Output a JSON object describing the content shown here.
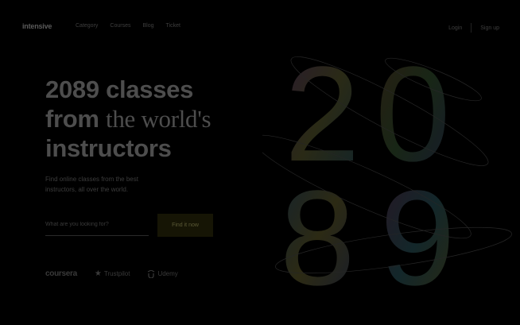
{
  "nav": {
    "logo": "intensive",
    "links": [
      "Category",
      "Courses",
      "Blog",
      "Ticket"
    ],
    "login": "Login",
    "signup": "Sign up"
  },
  "hero": {
    "line1": "2089 classes",
    "line2_sans": "from ",
    "line2_serif": "the world's",
    "line3": "instructors",
    "subtitle": "Find online classes from the best instructors, all over the world."
  },
  "form": {
    "placeholder": "What are you looking for?",
    "button": "Find it now"
  },
  "partners": {
    "coursera": "coursera",
    "trustpilot": "Trustpilot",
    "udemy": "Udemy"
  },
  "art": {
    "digits": [
      "2",
      "0",
      "8",
      "9"
    ]
  },
  "colors": {
    "background": "#000000",
    "button_bg": "#161505"
  }
}
